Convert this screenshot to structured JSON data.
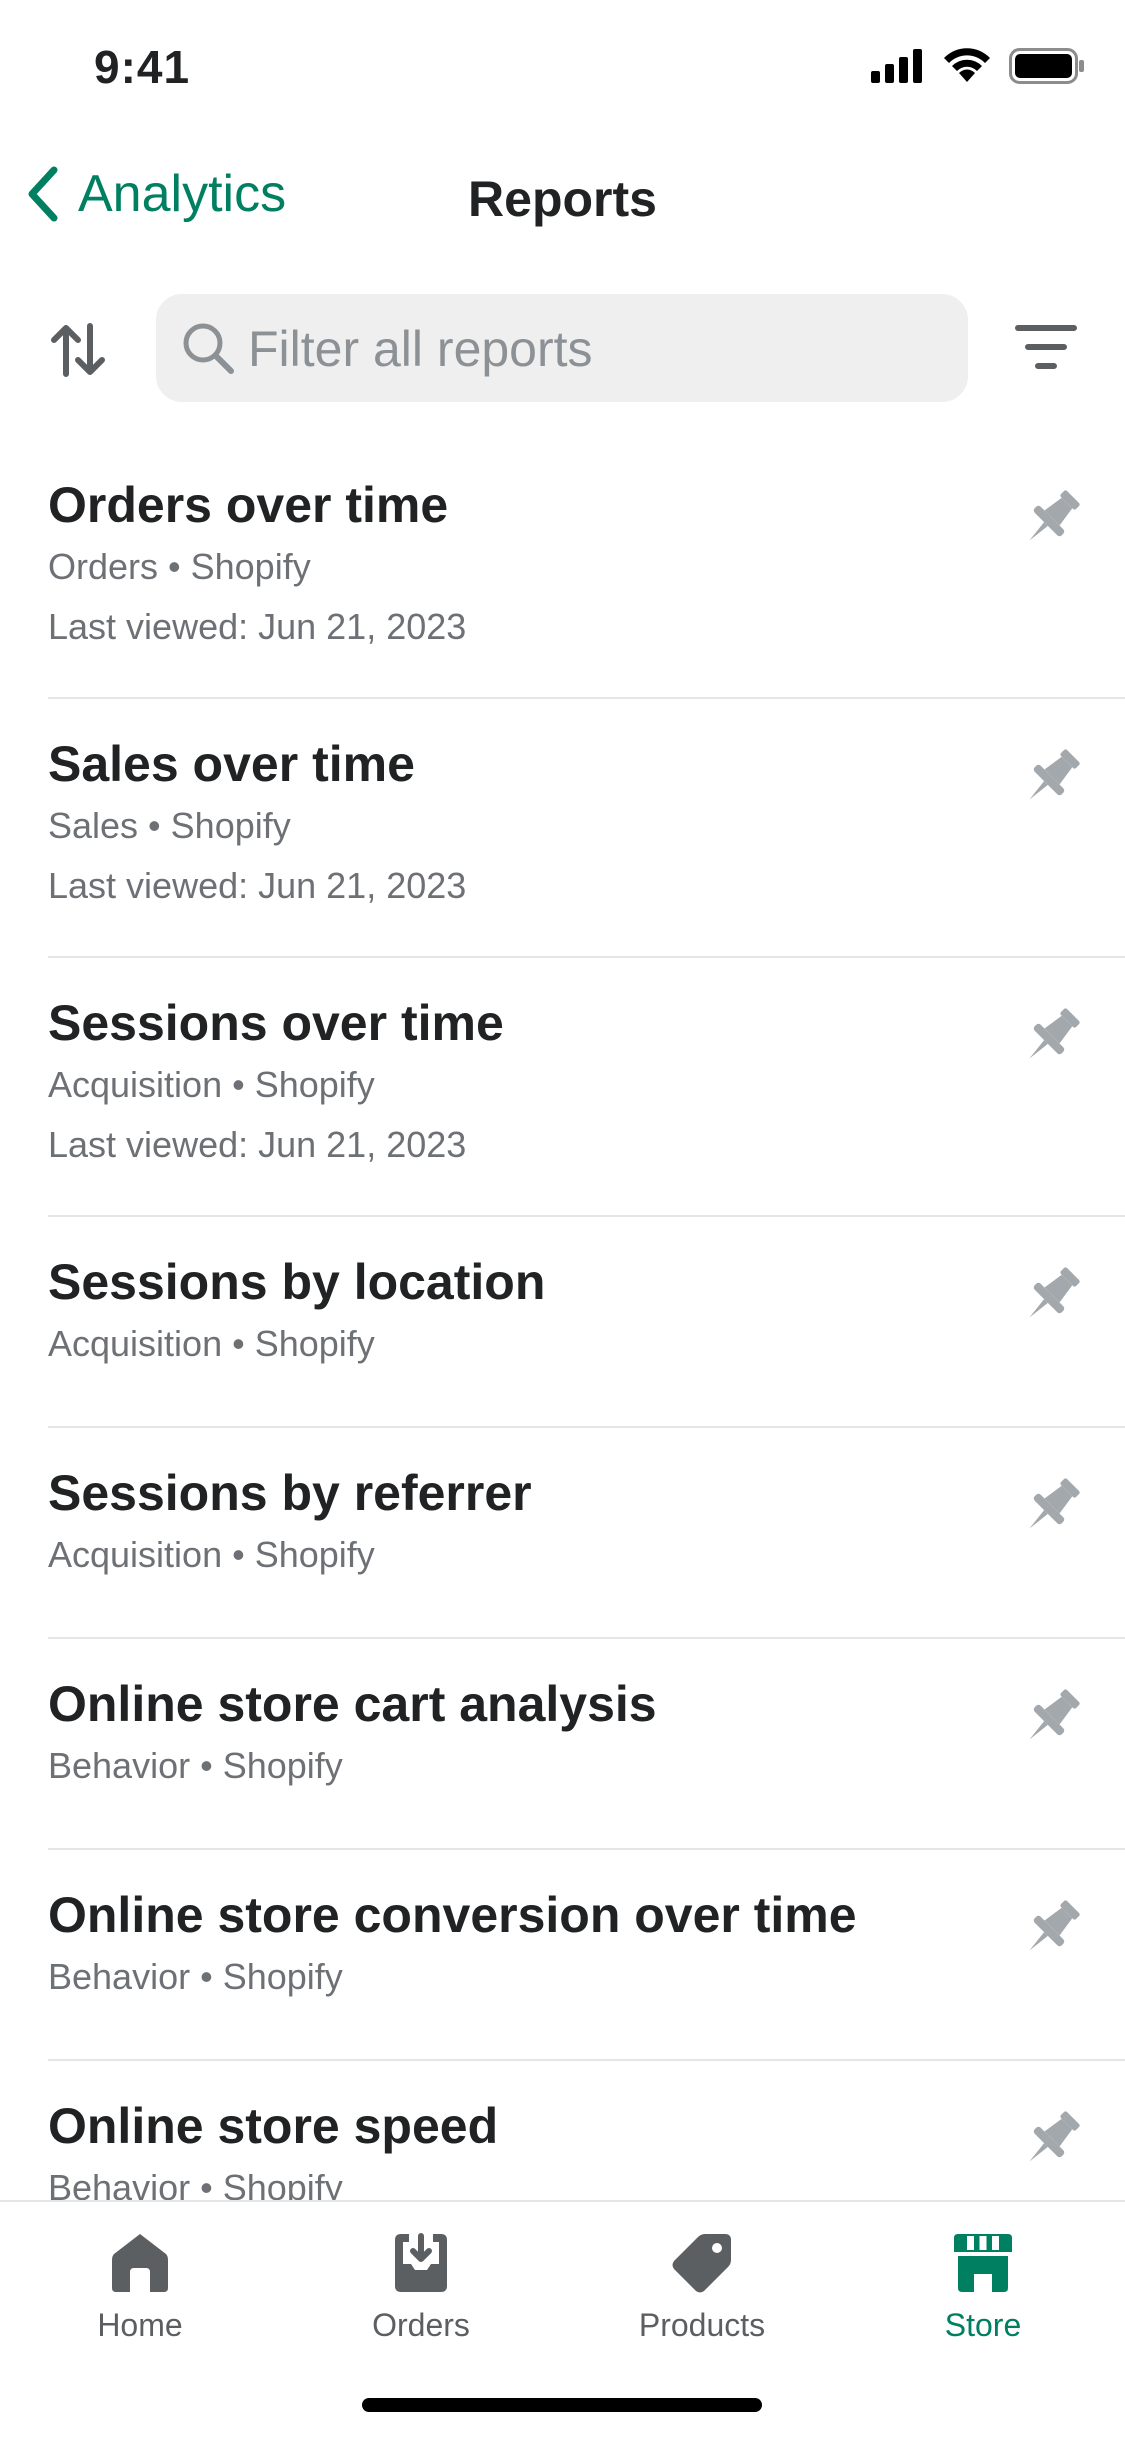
{
  "status": {
    "time": "9:41"
  },
  "nav": {
    "back_label": "Analytics",
    "title": "Reports"
  },
  "search": {
    "placeholder": "Filter all reports",
    "value": ""
  },
  "reports": [
    {
      "title": "Orders over time",
      "meta": "Orders • Shopify",
      "viewed": "Last viewed: Jun 21, 2023"
    },
    {
      "title": "Sales over time",
      "meta": "Sales • Shopify",
      "viewed": "Last viewed: Jun 21, 2023"
    },
    {
      "title": "Sessions over time",
      "meta": "Acquisition • Shopify",
      "viewed": "Last viewed: Jun 21, 2023"
    },
    {
      "title": "Sessions by location",
      "meta": "Acquisition • Shopify"
    },
    {
      "title": "Sessions by referrer",
      "meta": "Acquisition • Shopify"
    },
    {
      "title": "Online store cart analysis",
      "meta": "Behavior • Shopify"
    },
    {
      "title": "Online store conversion over time",
      "meta": "Behavior • Shopify"
    },
    {
      "title": "Online store speed",
      "meta": "Behavior • Shopify"
    }
  ],
  "tabs": [
    {
      "label": "Home",
      "icon": "home-icon"
    },
    {
      "label": "Orders",
      "icon": "orders-icon"
    },
    {
      "label": "Products",
      "icon": "tag-icon"
    },
    {
      "label": "Store",
      "icon": "store-icon",
      "active": true
    }
  ],
  "colors": {
    "accent": "#008060",
    "icon_gray": "#5c5f62",
    "pin_gray": "#a3a8ad"
  }
}
